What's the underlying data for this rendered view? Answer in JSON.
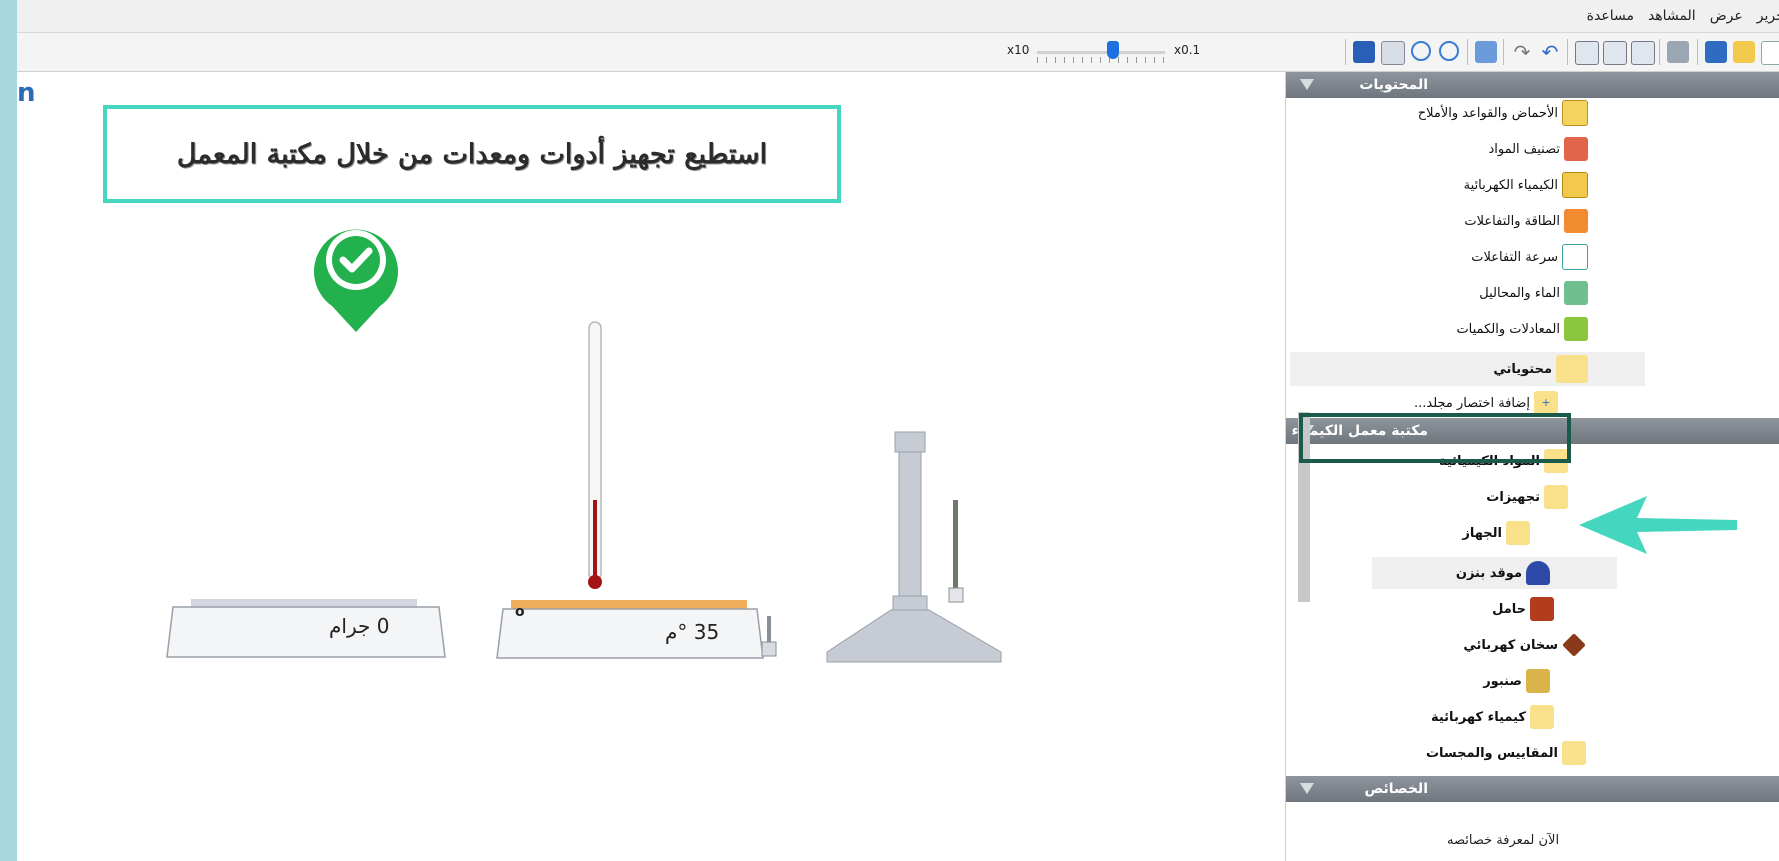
{
  "menu": {
    "items": [
      "تحرير",
      "عرض",
      "المشاهد",
      "مساعدة"
    ]
  },
  "toolbar": {
    "zoom_min_label": "x10",
    "zoom_max_label": "x0.1"
  },
  "workspace": {
    "banner_text": "استطيع تجهيز أدوات ومعدات من خلال مكتبة المعمل",
    "scale_reading": "0 جرام",
    "hotplate_reading": "35 °م",
    "hotplate_knob_symbol": "o"
  },
  "panel": {
    "contents_header": "المحتويات",
    "contents_items": [
      "الأحماض والقواعد والأملاح",
      "تصنيف المواد",
      "الكيمياء الكهربائية",
      "الطاقة والتفاعلات",
      "سرعة التفاعلات",
      "الماء والمحاليل",
      "المعادلات والكميات",
      "محتوياتي",
      "إضافة اختصار مجلد..."
    ],
    "library_header": "مكتبة معمل الكيمياء",
    "library_items": [
      "المواد الكيميائية",
      "تجهيزات",
      "الجهاز",
      "موقد بنزن",
      "حامل",
      "سخان كهربائي",
      "صنبور",
      "كيمياء كهربائية",
      "المقاييس والمجسات"
    ],
    "properties_header": "الخصائص",
    "properties_hint": "الآن لمعرفة خصائصه"
  },
  "colors": {
    "banner_border": "#45d6c0",
    "arrow": "#45d6c0",
    "check_pin": "#22b14c",
    "highlight_border": "#1a5a4a"
  },
  "icons": [
    "copy-icon",
    "paste-icon",
    "cut-icon",
    "print-icon",
    "save-icon",
    "open-icon",
    "new-icon",
    "undo-icon",
    "redo-icon",
    "zoom-in-icon",
    "zoom-out-icon",
    "grid-icon",
    "pause-icon"
  ]
}
